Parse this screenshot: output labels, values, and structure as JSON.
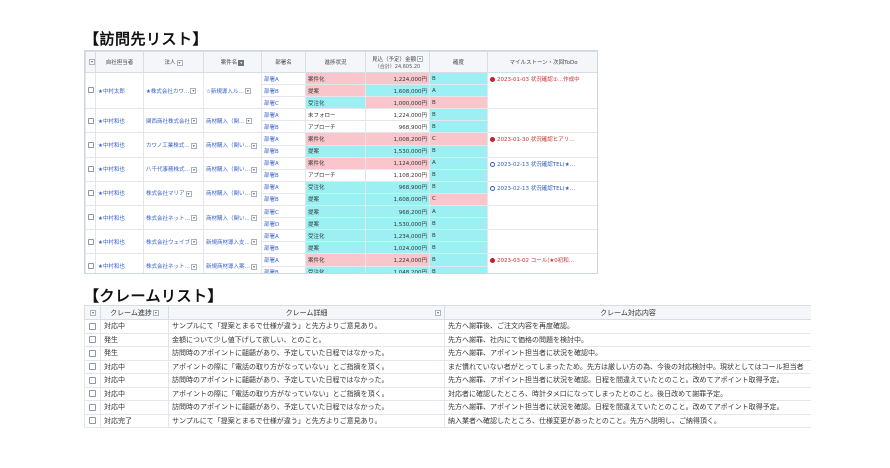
{
  "visit_title": "【訪問先リスト】",
  "claim_title": "【クレームリスト】",
  "visit": {
    "headers": {
      "owner": "自社担当者",
      "company": "法人",
      "product": "案件名",
      "dept": "部署名",
      "status": "進捗状況",
      "amount_label": "見込（予定）金額",
      "amount_total": "（合計）24,605.20",
      "rank": "確度",
      "milestone": "マイルストーン・次回ToDo"
    },
    "groups": [
      {
        "owner": "★中村太郎",
        "company": "★株式会社カワ…",
        "product": "☆新規導入ル…",
        "milestone": {
          "color": "red",
          "text": "2023-01-03",
          "note": "状況確認①…作成中"
        },
        "rows": [
          {
            "dept": "部署A",
            "status": "案件化",
            "amount": "1,224,000円",
            "rank": "B"
          },
          {
            "dept": "部署B",
            "status": "提案",
            "amount": "1,608,000円",
            "rank": "A"
          },
          {
            "dept": "部署C",
            "status": "受注化",
            "amount": "1,000,000円",
            "rank": "B"
          }
        ]
      },
      {
        "owner": "★中村和也",
        "company": "関西商社株式会社",
        "product": "商材購入（関…",
        "milestone": null,
        "rows": [
          {
            "dept": "部署A",
            "status": "未フォロー",
            "amount": "1,224,000円",
            "rank": "B"
          },
          {
            "dept": "部署B",
            "status": "アプローチ",
            "amount": "968,900円",
            "rank": "B"
          }
        ]
      },
      {
        "owner": "★中村和也",
        "company": "カワノ工業株式…",
        "product": "商材購入（関い…",
        "milestone": {
          "color": "red",
          "text": "2023-01-30",
          "note": "状況確認ヒアリ…"
        },
        "rows": [
          {
            "dept": "部署A",
            "status": "案件化",
            "amount": "1,008,200円",
            "rank": "C"
          },
          {
            "dept": "部署B",
            "status": "提案",
            "amount": "1,530,000円",
            "rank": "B"
          }
        ]
      },
      {
        "owner": "★中村和也",
        "company": "八千代事務株式…",
        "product": "商材購入（関い…",
        "milestone": {
          "color": "blue",
          "text": "2023-02-13",
          "note": "状況確認TEL(★…"
        },
        "rows": [
          {
            "dept": "部署A",
            "status": "案件化",
            "amount": "1,124,000円",
            "rank": "A"
          },
          {
            "dept": "部署B",
            "status": "アプローチ",
            "amount": "1,108,200円",
            "rank": "B"
          }
        ]
      },
      {
        "owner": "★中村和也",
        "company": "株式会社マリア",
        "product": "商材購入（関い…",
        "milestone": {
          "color": "blue",
          "text": "2023-02-13",
          "note": "状況確認TEL(★…"
        },
        "rows": [
          {
            "dept": "部署A",
            "status": "受注化",
            "amount": "968,900円",
            "rank": "B"
          },
          {
            "dept": "部署B",
            "status": "提案",
            "amount": "1,608,000円",
            "rank": "C"
          }
        ]
      },
      {
        "owner": "★中村和也",
        "company": "株式会社ネット…",
        "product": "商材購入（関い…",
        "milestone": null,
        "rows": [
          {
            "dept": "部署C",
            "status": "提案",
            "amount": "968,200円",
            "rank": "A"
          },
          {
            "dept": "部署D",
            "status": "提案",
            "amount": "1,530,000円",
            "rank": "B"
          }
        ]
      },
      {
        "owner": "★中村和也",
        "company": "株式会社ウェイブ",
        "product": "新規商材導入支…",
        "milestone": null,
        "rows": [
          {
            "dept": "部署A",
            "status": "受注化",
            "amount": "1,234,000円",
            "rank": "B"
          },
          {
            "dept": "部署B",
            "status": "提案",
            "amount": "1,024,000円",
            "rank": "B"
          }
        ]
      },
      {
        "owner": "★中村和也",
        "company": "株式会社ネット…",
        "product": "新規商材導入案…",
        "milestone": {
          "color": "red",
          "text": "2023-03-02",
          "note": "コール(★0初和…"
        },
        "rows": [
          {
            "dept": "部署A",
            "status": "案件化",
            "amount": "1,224,000円",
            "rank": "B"
          },
          {
            "dept": "部署B",
            "status": "受注化",
            "amount": "1,048,200円",
            "rank": "B"
          }
        ]
      }
    ]
  },
  "claim": {
    "headers": {
      "status": "クレーム進捗",
      "detail": "クレーム詳細",
      "response": "クレーム対応内容"
    },
    "rows": [
      {
        "status": "対応中",
        "detail": "サンプルにて「提案とまるで仕様が違う」と先方よりご意見あり。",
        "response": "先方へ謝罪後、ご注文内容を再度確認。"
      },
      {
        "status": "発生",
        "detail": "金額について少し値下げして欲しい、とのこと。",
        "response": "先方へ謝罪、社内にて価格の問題を検討中。"
      },
      {
        "status": "発生",
        "detail": "訪問時のアポイントに齟齬があり、予定していた日程ではなかった。",
        "response": "先方へ謝罪、アポイント担当者に状況を確認中。"
      },
      {
        "status": "対応中",
        "detail": "アポイントの際に「電話の取り方がなっていない」とご指摘を頂く。",
        "response": "まだ慣れていない者がとってしまったため。先方は厳しい方の為、今後の対応検討中。現状としてはコール担当者"
      },
      {
        "status": "対応中",
        "detail": "訪問時のアポイントに齟齬があり、予定していた日程ではなかった。",
        "response": "先方へ謝罪、アポイント担当者に状況を確認。日程を間違えていたとのこと。改めてアポイント取得予定。"
      },
      {
        "status": "対応中",
        "detail": "アポイントの際に「電話の取り方がなっていない」とご指摘を頂く。",
        "response": "対応者に確認したところ、時計タメ口になってしまったとのこと。後日改めて謝罪予定。"
      },
      {
        "status": "対応中",
        "detail": "訪問時のアポイントに齟齬があり、予定していた日程ではなかった。",
        "response": "先方へ謝罪、アポイント担当者に状況を確認。日程を間違えていたとのこと。改めてアポイント取得予定。"
      },
      {
        "status": "対応完了",
        "detail": "サンプルにて「提案とまるで仕様が違う」と先方よりご意見あり。",
        "response": "納入業者へ確認したところ、仕様変更があったとのこと。先方へ説明し、ご納得頂く。"
      }
    ]
  }
}
